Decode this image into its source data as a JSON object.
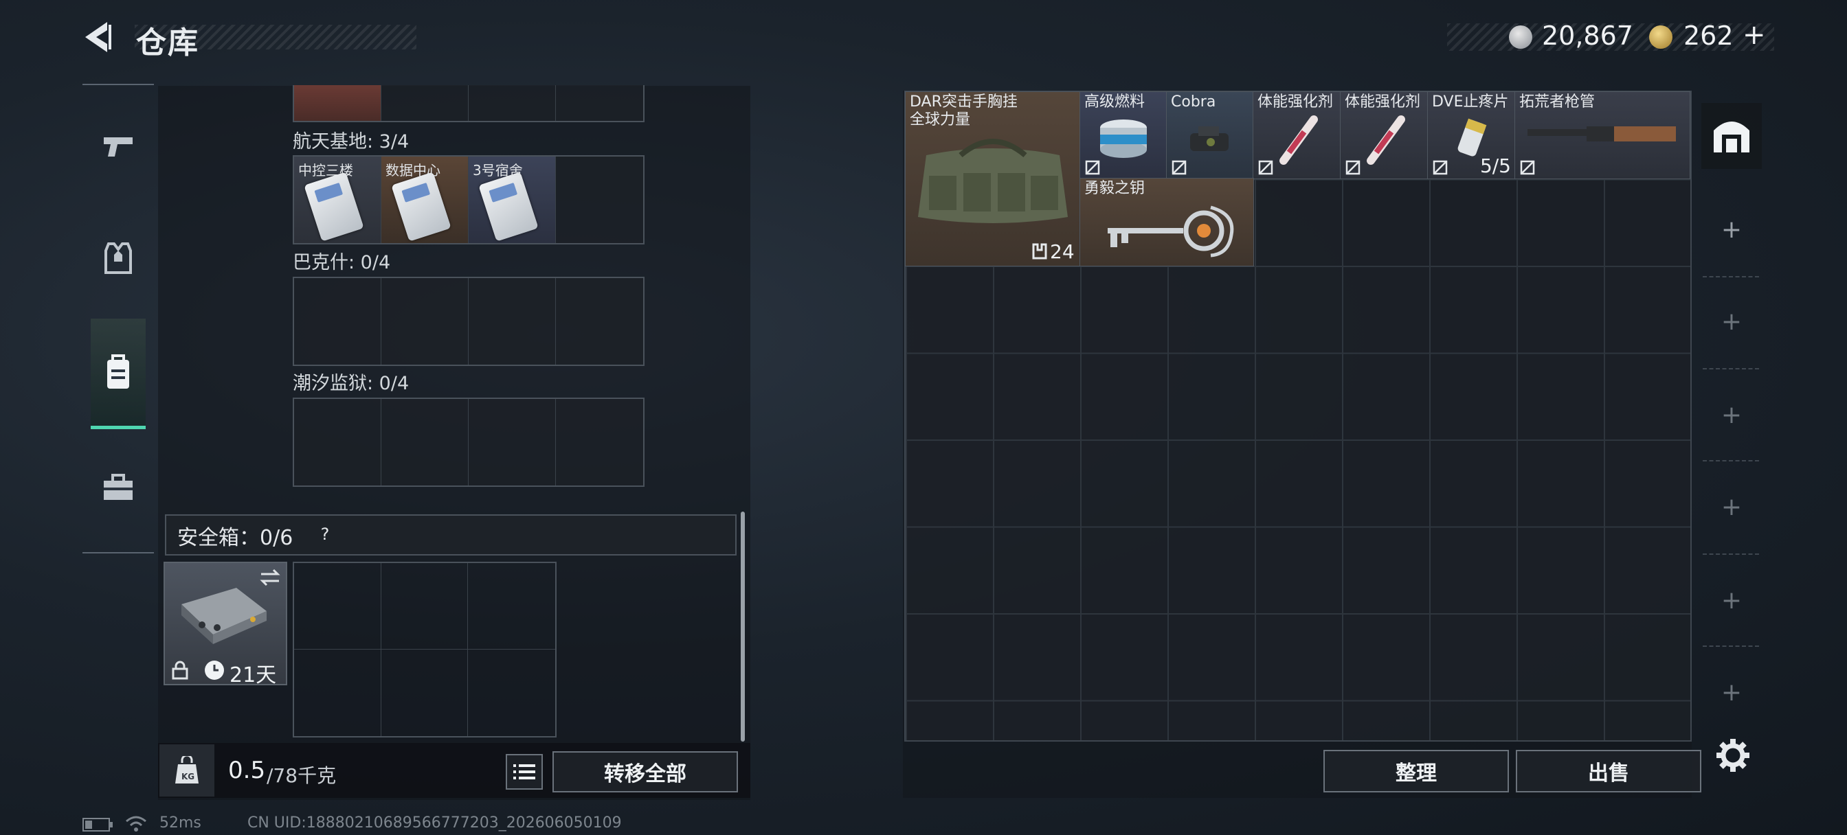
{
  "header": {
    "title": "仓库",
    "currency_silver": "20,867",
    "currency_gold": "262",
    "add_label": "+"
  },
  "sidebar": {
    "items": [
      {
        "name": "weapons",
        "icon": "pistol-icon"
      },
      {
        "name": "armor",
        "icon": "vest-icon"
      },
      {
        "name": "backpack",
        "icon": "backpack-icon",
        "active": true
      },
      {
        "name": "toolbox",
        "icon": "toolbox-icon"
      }
    ]
  },
  "keycards": {
    "sections": [
      {
        "label": "航天基地: 3/4",
        "cards": [
          "中控三楼",
          "数据中心",
          "3号宿舍"
        ]
      },
      {
        "label": "巴克什: 0/4",
        "cards": []
      },
      {
        "label": "潮汐监狱: 0/4",
        "cards": []
      }
    ]
  },
  "safe": {
    "label": "安全箱：0/6",
    "help": "?",
    "duration": "21天"
  },
  "weight": {
    "current": "0.5",
    "max_unit": "/78千克",
    "transfer_all": "转移全部"
  },
  "storage": {
    "items": [
      {
        "name_line1": "DAR突击手胸挂",
        "name_line2": "全球力量",
        "count": "24"
      },
      {
        "name": "高级燃料"
      },
      {
        "name": "Cobra"
      },
      {
        "name": "体能强化剂"
      },
      {
        "name": "体能强化剂"
      },
      {
        "name": "DVE止疼片",
        "count": "5/5"
      },
      {
        "name": "拓荒者枪管"
      },
      {
        "name": "勇毅之钥"
      }
    ],
    "sort_label": "整理",
    "sell_label": "出售"
  },
  "status": {
    "ping": "52ms",
    "uid": "CN UID:18880210689566777203_202606050109"
  }
}
